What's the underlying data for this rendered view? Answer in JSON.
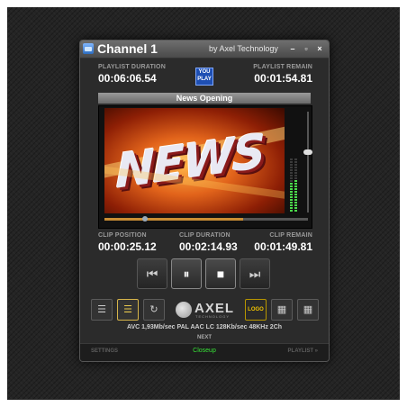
{
  "window": {
    "title": "Channel 1",
    "byline": "by Axel Technology",
    "controls": {
      "minimize": "–",
      "maximize": "▫",
      "close": "×"
    }
  },
  "playlist": {
    "duration_label": "PLAYLIST DURATION",
    "duration_value": "00:06:06.54",
    "remain_label": "PLAYLIST REMAIN",
    "remain_value": "00:01:54.81"
  },
  "brand_badge": {
    "line1": "YOU",
    "line2": "PLAY"
  },
  "clip_title": "News Opening",
  "preview": {
    "overlay_text": "NEWS"
  },
  "meters": {
    "vu_left": 0.55,
    "vu_right": 0.6,
    "volume": 0.6
  },
  "seek": {
    "position": 0.2,
    "buffered": 0.68
  },
  "clip": {
    "position_label": "CLIP POSITION",
    "position_value": "00:00:25.12",
    "duration_label": "CLIP DURATION",
    "duration_value": "00:02:14.93",
    "remain_label": "CLIP REMAIN",
    "remain_value": "00:01:49.81"
  },
  "transport": {
    "prev_icon": "skip-back-icon",
    "pause_icon": "pause-icon",
    "stop_icon": "stop-icon",
    "next_icon": "skip-forward-icon"
  },
  "toolbar": {
    "logo_button": "LOGO",
    "logo_name": "AXEL",
    "logo_sub": "TECHNOLOGY"
  },
  "info_line": "AVC  1,93Mb/sec PAL  AAC LC 128Kb/sec 48KHz 2Ch",
  "next": {
    "label": "NEXT",
    "clip": "Closeup"
  },
  "footer": {
    "settings": "SETTINGS",
    "playlist": "PLAYLIST »"
  },
  "colors": {
    "accent_green": "#37e237",
    "accent_gold": "#e8c84e",
    "window_bg": "#2b2b2b"
  }
}
